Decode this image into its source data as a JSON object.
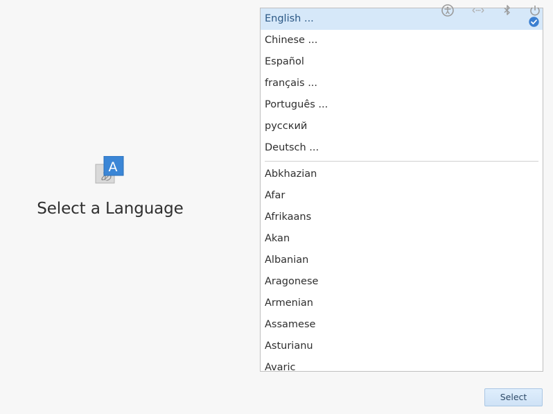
{
  "header": {
    "title": "Select a Language"
  },
  "languages": {
    "featured": [
      "English ...",
      "Chinese ...",
      "Español",
      "français ...",
      "Português ...",
      "русский",
      "Deutsch ..."
    ],
    "all": [
      "Abkhazian",
      "Afar",
      "Afrikaans",
      "Akan",
      "Albanian",
      "Aragonese",
      "Armenian",
      "Assamese",
      "Asturianu",
      "Avaric"
    ],
    "selected": "English ..."
  },
  "tray_icons": [
    "accessibility-icon",
    "network-icon",
    "bluetooth-icon",
    "power-icon"
  ],
  "footer": {
    "select_label": "Select"
  },
  "colors": {
    "selection_bg": "#d6e8f9",
    "accent": "#3b7fd1",
    "button_bg": "#d6e8f9"
  }
}
